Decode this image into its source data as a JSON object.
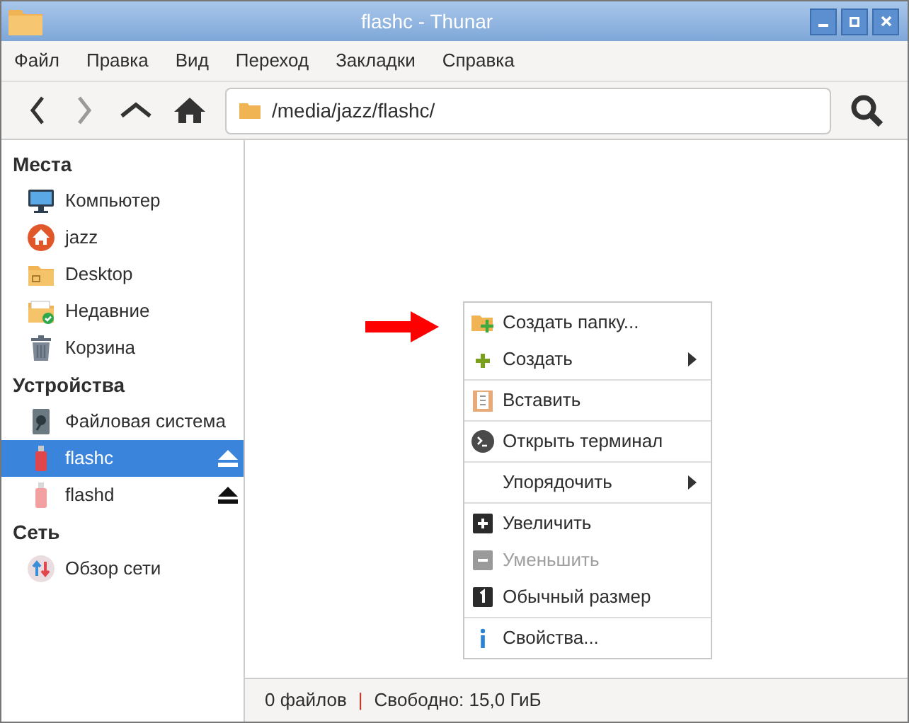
{
  "window": {
    "title": "flashc - Thunar"
  },
  "menu_bar": [
    "Файл",
    "Правка",
    "Вид",
    "Переход",
    "Закладки",
    "Справка"
  ],
  "toolbar": {
    "back_disabled": false,
    "forward_disabled": true,
    "location": "/media/jazz/flashc/"
  },
  "sidebar": [
    {
      "title": "Места",
      "items": [
        {
          "label": "Компьютер",
          "kind": "computer",
          "selected": false
        },
        {
          "label": "jazz",
          "kind": "home",
          "selected": false
        },
        {
          "label": "Desktop",
          "kind": "desktop",
          "selected": false
        },
        {
          "label": "Недавние",
          "kind": "recent",
          "selected": false
        },
        {
          "label": "Корзина",
          "kind": "trash",
          "selected": false
        }
      ]
    },
    {
      "title": "Устройства",
      "items": [
        {
          "label": "Файловая система",
          "kind": "drive",
          "selected": false,
          "eject": false
        },
        {
          "label": "flashc",
          "kind": "usb",
          "selected": true,
          "eject": true
        },
        {
          "label": "flashd",
          "kind": "usb-light",
          "selected": false,
          "eject": true
        }
      ]
    },
    {
      "title": "Сеть",
      "items": [
        {
          "label": "Обзор сети",
          "kind": "network",
          "selected": false
        }
      ]
    }
  ],
  "context_menu": {
    "sections": [
      [
        {
          "label": "Создать папку...",
          "kind": "new-folder",
          "disabled": false,
          "submenu": false
        },
        {
          "label": "Создать",
          "kind": "plus",
          "disabled": false,
          "submenu": true
        }
      ],
      [
        {
          "label": "Вставить",
          "kind": "paste",
          "disabled": false,
          "submenu": false
        }
      ],
      [
        {
          "label": "Открыть терминал",
          "kind": "terminal",
          "disabled": false,
          "submenu": false
        }
      ],
      [
        {
          "label": "Упорядочить",
          "kind": "plain",
          "disabled": false,
          "submenu": true
        }
      ],
      [
        {
          "label": "Увеличить",
          "kind": "zoom-in",
          "disabled": false,
          "submenu": false
        },
        {
          "label": "Уменьшить",
          "kind": "zoom-out",
          "disabled": true,
          "submenu": false
        },
        {
          "label": "Обычный размер",
          "kind": "zoom-normal",
          "disabled": false,
          "submenu": false
        }
      ],
      [
        {
          "label": "Свойства...",
          "kind": "info",
          "disabled": false,
          "submenu": false
        }
      ]
    ]
  },
  "status_bar": {
    "files": "0 файлов",
    "separator": "|",
    "free": "Свободно: 15,0 ГиБ"
  }
}
